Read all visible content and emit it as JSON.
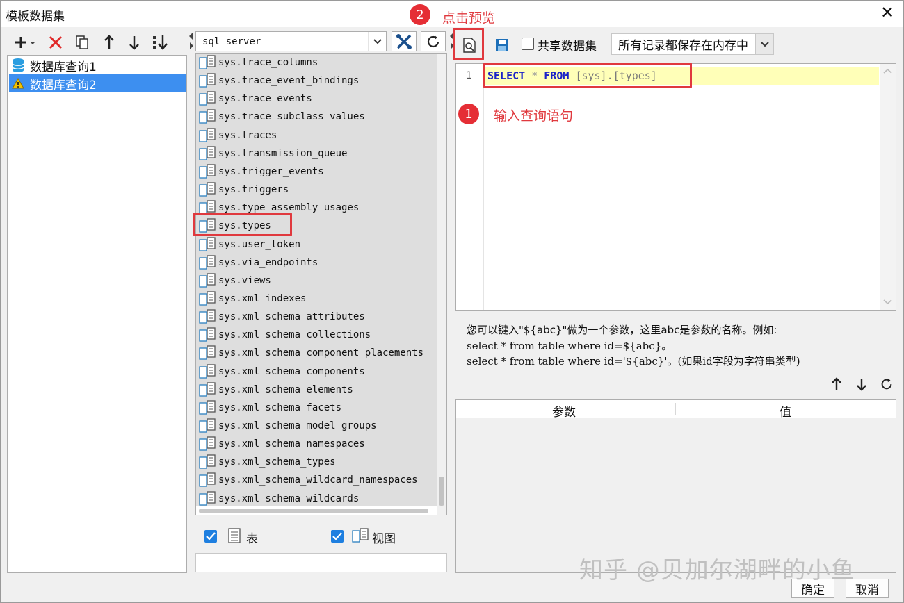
{
  "window": {
    "title": "模板数据集",
    "close_label": "✕"
  },
  "left": {
    "toolbar": [
      {
        "name": "add-icon",
        "label": "+"
      },
      {
        "name": "delete-icon",
        "label": "✕"
      },
      {
        "name": "copy-icon",
        "label": ""
      },
      {
        "name": "move-up-icon",
        "label": ""
      },
      {
        "name": "move-down-icon",
        "label": ""
      },
      {
        "name": "sort-icon",
        "label": ""
      }
    ],
    "datasets": [
      {
        "label": "数据库查询1",
        "icon": "database-icon",
        "selected": false
      },
      {
        "label": "数据库查询2",
        "icon": "warning-icon",
        "selected": true
      }
    ]
  },
  "middle": {
    "connection": "sql server",
    "tables": [
      "sys.trace_columns",
      "sys.trace_event_bindings",
      "sys.trace_events",
      "sys.trace_subclass_values",
      "sys.traces",
      "sys.transmission_queue",
      "sys.trigger_events",
      "sys.triggers",
      "sys.type_assembly_usages",
      "sys.types",
      "sys.user_token",
      "sys.via_endpoints",
      "sys.views",
      "sys.xml_indexes",
      "sys.xml_schema_attributes",
      "sys.xml_schema_collections",
      "sys.xml_schema_component_placements",
      "sys.xml_schema_components",
      "sys.xml_schema_elements",
      "sys.xml_schema_facets",
      "sys.xml_schema_model_groups",
      "sys.xml_schema_namespaces",
      "sys.xml_schema_types",
      "sys.xml_schema_wildcard_namespaces",
      "sys.xml_schema_wildcards"
    ],
    "filter": {
      "table_label": "表",
      "view_label": "视图",
      "table_checked": true,
      "view_checked": true
    }
  },
  "right": {
    "share_label": "共享数据集",
    "share_checked": false,
    "memory_option": "所有记录都保存在内存中",
    "editor": {
      "line_number": "1",
      "sql": {
        "kw1": "SELECT",
        "star": "*",
        "kw2": "FROM",
        "target": "[sys].[types]"
      }
    },
    "hint": {
      "line1": "您可以键入\"${abc}\"做为一个参数，这里abc是参数的名称。例如:",
      "line2": "select * from table where id=${abc}。",
      "line3": "select * from table where id='${abc}'。(如果id字段为字符串类型)"
    },
    "params": {
      "col_param": "参数",
      "col_value": "值"
    }
  },
  "buttons": {
    "ok": "确定",
    "cancel": "取消"
  },
  "annotations": {
    "step1_num": "1",
    "step1_text": "输入查询语句",
    "step2_num": "2",
    "step2_text": "点击预览",
    "color": "#e0393e"
  },
  "watermark": "知乎 @贝加尔湖畔的小鱼"
}
